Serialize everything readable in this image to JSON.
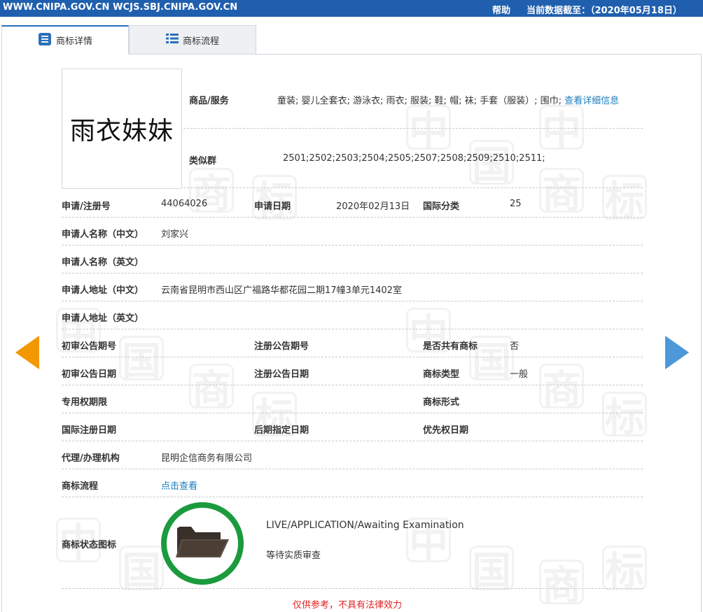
{
  "topbar": {
    "sites": "WWW.CNIPA.GOV.CN WCJS.SBJ.CNIPA.GOV.CN",
    "help": "帮助",
    "data_date": "当前数据截至：（2020年05月18日）"
  },
  "tabs": [
    {
      "label": "商标详情",
      "active": true
    },
    {
      "label": "商标流程",
      "active": false
    }
  ],
  "mark": {
    "image_text": "雨衣妹妹",
    "goods_label": "商品/服务",
    "goods_value": "童装; 婴儿全套衣; 游泳衣; 雨衣; 服装; 鞋; 帽; 袜; 手套（服装）; 围巾;",
    "goods_link": "查看详细信息",
    "similar_label": "类似群",
    "similar_value": "2501;2502;2503;2504;2505;2507;2508;2509;2510;2511;"
  },
  "details": {
    "reg_no_label": "申请/注册号",
    "reg_no": "44064026",
    "app_date_label": "申请日期",
    "app_date": "2020年02月13日",
    "intl_class_label": "国际分类",
    "intl_class": "25",
    "applicant_cn_label": "申请人名称（中文）",
    "applicant_cn": "刘家兴",
    "applicant_en_label": "申请人名称（英文）",
    "address_cn_label": "申请人地址（中文）",
    "address_cn": "云南省昆明市西山区广福路华都花园二期17幢3单元1402室",
    "address_en_label": "申请人地址（英文）",
    "prelim_issue_label": "初审公告期号",
    "reg_issue_label": "注册公告期号",
    "shared_label": "是否共有商标",
    "shared": "否",
    "prelim_date_label": "初审公告日期",
    "reg_date_label": "注册公告日期",
    "mark_type_label": "商标类型",
    "mark_type": "一般",
    "exclusive_label": "专用权期限",
    "mark_form_label": "商标形式",
    "intl_reg_label": "国际注册日期",
    "later_designation_label": "后期指定日期",
    "priority_label": "优先权日期",
    "agent_label": "代理/办理机构",
    "agent": "昆明企信商务有限公司",
    "flow_label": "商标流程",
    "flow_link": "点击查看",
    "status_icon_label": "商标状态图标",
    "status_en": "LIVE/APPLICATION/Awaiting Examination",
    "status_cn": "等待实质审查"
  },
  "disclaimer": "仅供参考，不具有法律效力",
  "colors": {
    "topbar": "#1f5fae",
    "link": "#1a7dbf",
    "prev_arrow": "#f39800",
    "next_arrow": "#4c98d9",
    "status_ring": "#1b9a3e",
    "disclaimer": "#e02020"
  },
  "icons": {
    "tab_details": "document-list-icon",
    "tab_flow": "list-icon",
    "prev": "chevron-left-icon",
    "next": "chevron-right-icon",
    "status": "folder-icon"
  }
}
